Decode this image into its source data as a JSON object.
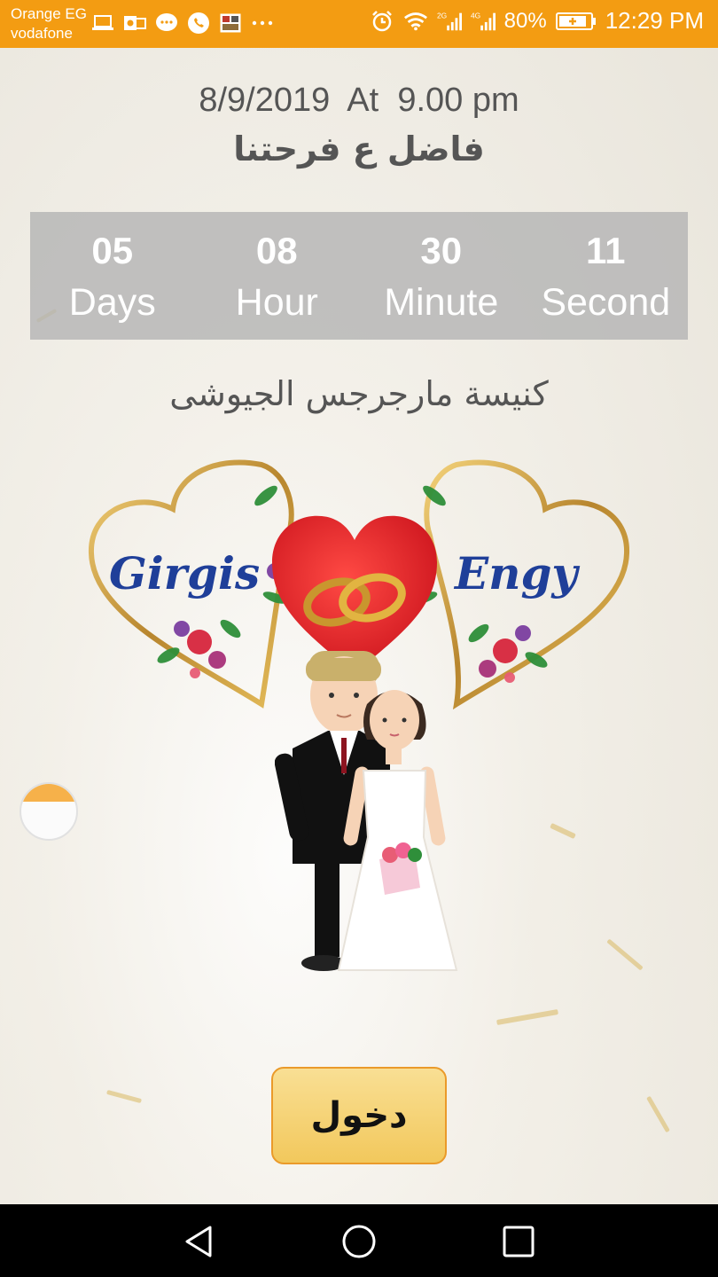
{
  "status_bar": {
    "carrier_1": "Orange EG",
    "carrier_2": "vodafone",
    "battery": "80%",
    "time": "12:29 PM",
    "color": "#f39c12",
    "left_icons": [
      "laptop-icon",
      "outlook-icon",
      "chat-bubble-icon",
      "whatsapp-icon",
      "image-app-icon",
      "more-dots-icon"
    ],
    "right_icons": [
      "alarm-icon",
      "wifi-icon",
      "signal-2g-icon",
      "signal-4g-icon",
      "battery-icon"
    ]
  },
  "header": {
    "date_line": "8/9/2019  At  9.00 pm",
    "subtitle": "فاضل ع فرحتنا"
  },
  "countdown": {
    "cells": [
      {
        "value": "05",
        "label": "Days"
      },
      {
        "value": "08",
        "label": "Hour"
      },
      {
        "value": "30",
        "label": "Minute"
      },
      {
        "value": "11",
        "label": "Second"
      }
    ]
  },
  "venue": "كنيسة مارجرجس الجيوشى",
  "emblem": {
    "groom_name": "Girgis",
    "bride_name": "Engy",
    "name_color": "#1f3f99",
    "heart_color": "#e0262b",
    "gold_color": "#b8862e"
  },
  "enter_button": {
    "label": "دخول",
    "fill": "#f2c85c",
    "border": "#ea9a2a"
  },
  "nav_bar": {
    "icons": [
      "back-triangle-icon",
      "home-circle-icon",
      "recents-square-icon"
    ]
  }
}
